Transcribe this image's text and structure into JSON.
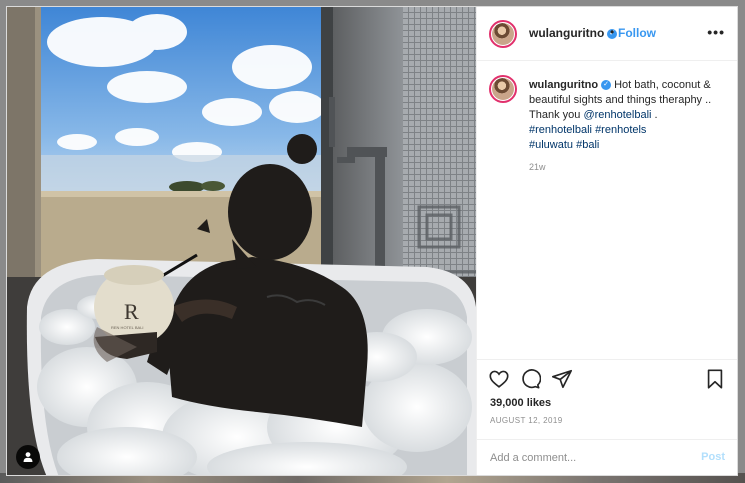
{
  "post": {
    "username": "wulanguritno",
    "verified_icon": "verified-badge-icon",
    "dot": "•",
    "follow_label": "Follow",
    "more_label": "•••",
    "caption_text": "Hot bath, coconut & beautiful sights and things theraphy .. Thank you",
    "mention": "@renhotelbali",
    "caption_end": ".",
    "hashtags_line1": [
      "#renhotelbali",
      "#renhotels"
    ],
    "hashtags_line2": [
      "#uluwatu",
      "#bali"
    ],
    "time_ago": "21w",
    "likes": "39,000 likes",
    "date": "AUGUST 12, 2019",
    "comment_placeholder": "Add a comment...",
    "post_label": "Post"
  },
  "photo": {
    "coconut_letter": "R",
    "coconut_brand": "REN HOTEL BALI"
  },
  "icons": {
    "like": "heart-icon",
    "comment": "comment-icon",
    "share": "share-icon",
    "save": "bookmark-icon",
    "tag": "user-tag-icon"
  },
  "colors": {
    "link": "#003569",
    "follow": "#3897f0",
    "post_disabled": "#b2dffc",
    "avatar_ring": "#e1306c"
  }
}
